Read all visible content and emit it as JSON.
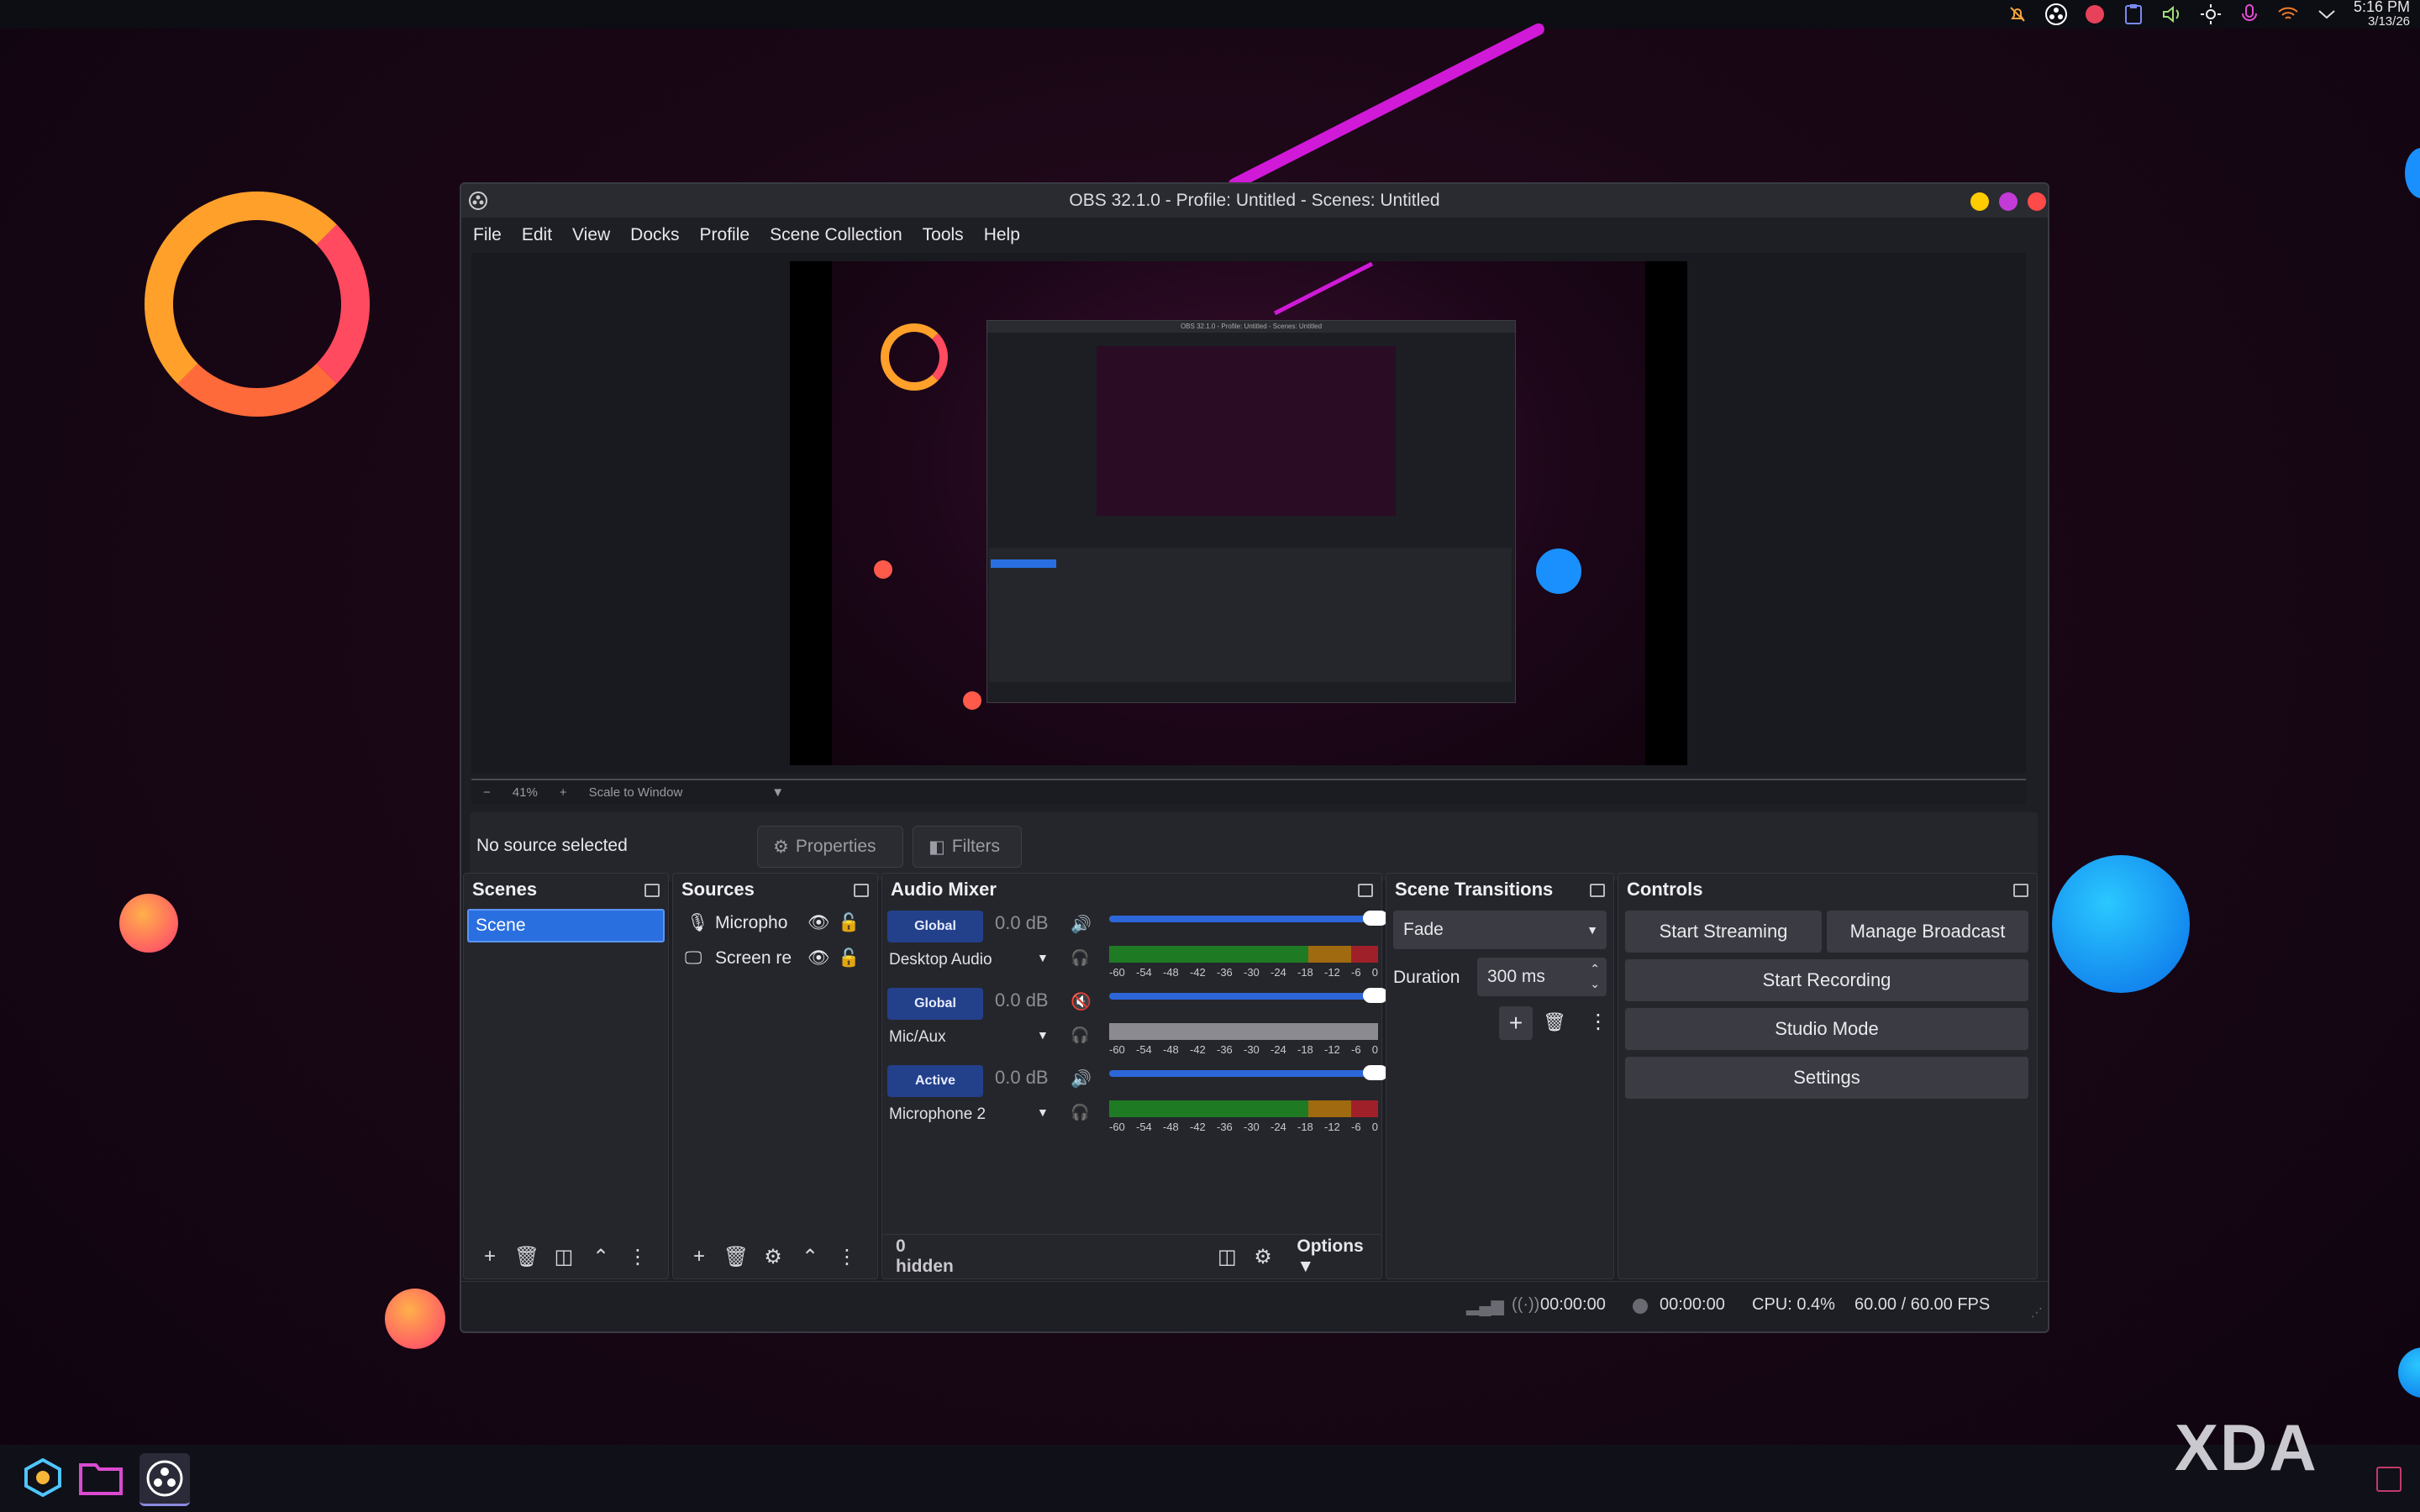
{
  "tray": {
    "time": "5:16 PM",
    "date": "3/13/26",
    "icons": [
      "bell-off-icon",
      "obs-tray-icon",
      "record-dot-icon",
      "clipboard-icon",
      "volume-icon",
      "brightness-icon",
      "mic-icon",
      "wifi-icon",
      "chevron-down-icon"
    ]
  },
  "window": {
    "title": "OBS 32.1.0 - Profile: Untitled - Scenes: Untitled"
  },
  "menu": [
    "File",
    "Edit",
    "View",
    "Docks",
    "Profile",
    "Scene Collection",
    "Tools",
    "Help"
  ],
  "preview": {
    "zoom": "41%",
    "zoom_minus": "−",
    "zoom_plus": "+",
    "scale_mode": "Scale to Window"
  },
  "source_bar": {
    "status": "No source selected",
    "properties": "Properties",
    "filters": "Filters"
  },
  "scenes": {
    "title": "Scenes",
    "items": [
      "Scene"
    ]
  },
  "sources": {
    "title": "Sources",
    "items": [
      "Micropho",
      "Screen re"
    ]
  },
  "audio_mixer": {
    "title": "Audio Mixer",
    "channels": [
      {
        "badge": "Global",
        "db": "0.0 dB",
        "name": "Desktop Audio",
        "muted": false
      },
      {
        "badge": "Global",
        "db": "0.0 dB",
        "name": "Mic/Aux",
        "muted": true
      },
      {
        "badge": "Active",
        "db": "0.0 dB",
        "name": "Microphone 2",
        "muted": false
      }
    ],
    "scale": [
      "-60",
      "-54",
      "-48",
      "-42",
      "-36",
      "-30",
      "-24",
      "-18",
      "-12",
      "-6",
      "0"
    ],
    "hidden": "0 hidden",
    "options": "Options"
  },
  "transitions": {
    "title": "Scene Transitions",
    "selected": "Fade",
    "duration_label": "Duration",
    "duration_value": "300 ms"
  },
  "controls": {
    "title": "Controls",
    "start_streaming": "Start Streaming",
    "manage_broadcast": "Manage Broadcast",
    "start_recording": "Start Recording",
    "studio_mode": "Studio Mode",
    "settings": "Settings"
  },
  "status": {
    "stream_time": "00:00:00",
    "record_time": "00:00:00",
    "cpu": "CPU: 0.4%",
    "fps": "60.00 / 60.00 FPS"
  },
  "nested": {
    "title": "OBS 32.1.0 - Profile: Untitled - Scenes: Untitled"
  },
  "watermark": "XDA",
  "colors": {
    "accent": "#2a6fe0",
    "badge": "#23408a",
    "close": "#ff4a4a",
    "minimize": "#ffcc00",
    "maximize": "#c23bd6"
  }
}
